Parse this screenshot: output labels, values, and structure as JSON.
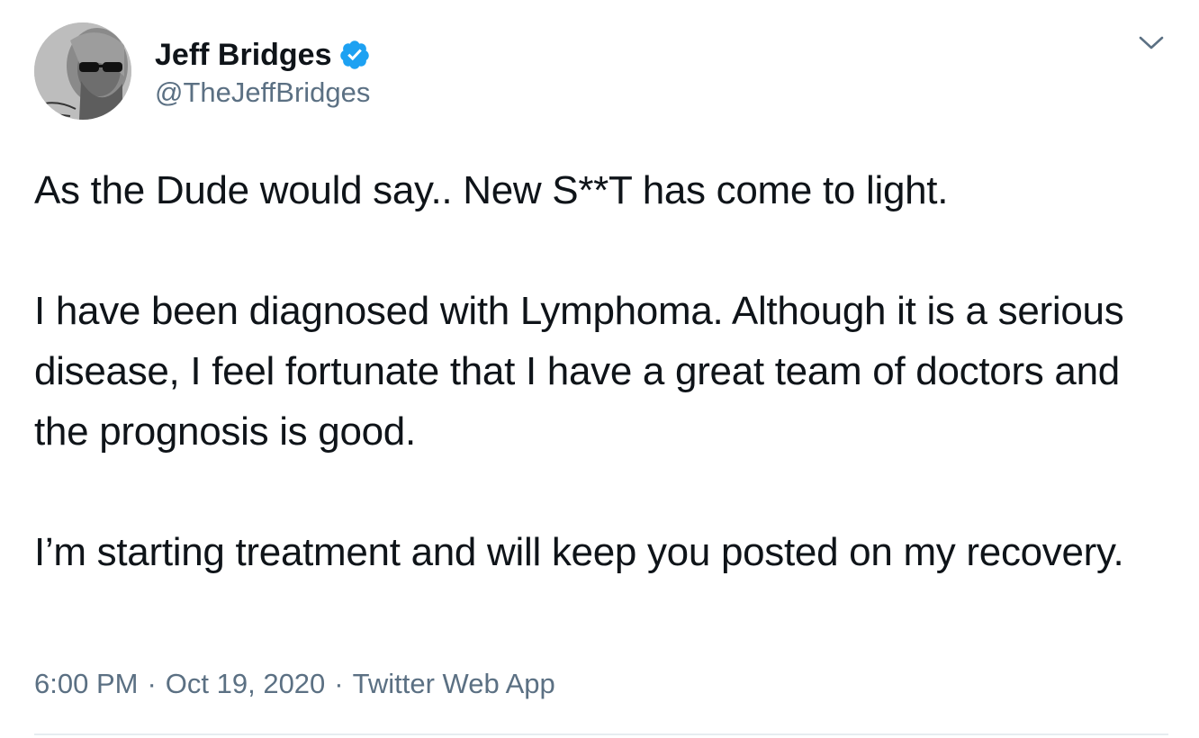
{
  "tweet": {
    "author": {
      "display_name": "Jeff Bridges",
      "handle": "@TheJeffBridges",
      "verified": true,
      "avatar_icon": "profile-photo",
      "verified_icon": "verified-badge-icon",
      "verified_color": "#1da1f2"
    },
    "menu_icon": "chevron-down-icon",
    "paragraphs": [
      "As the Dude would say.. New S**T has come to light.",
      "I have been diagnosed with Lymphoma. Although it is a serious disease, I feel fortunate that I have a great team of doctors and the prognosis is good.",
      "I’m starting treatment and will keep you posted on my recovery."
    ],
    "time": "6:00 PM",
    "date": "Oct 19, 2020",
    "separator": "·",
    "source": "Twitter Web App"
  },
  "colors": {
    "text_primary": "#0f1419",
    "text_secondary": "#5b7083",
    "accent": "#1da1f2",
    "divider": "#e6ecf0"
  }
}
